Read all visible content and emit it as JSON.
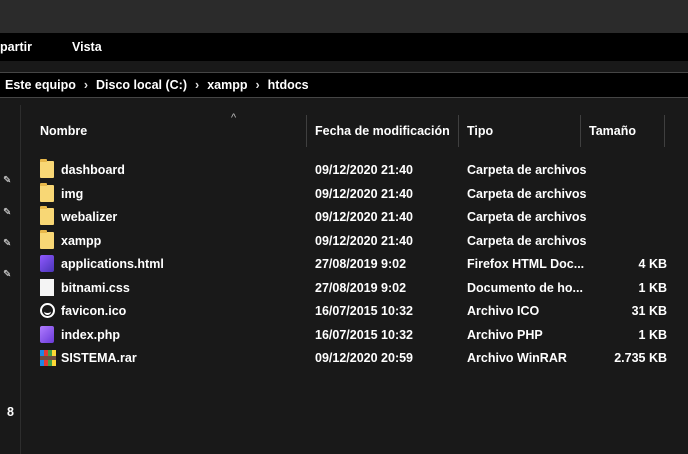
{
  "ribbon": {
    "compartir_label": "partir",
    "vista_label": "Vista"
  },
  "address": {
    "breadcrumbs": [
      "Este equipo",
      "Disco local (C:)",
      "xampp",
      "htdocs"
    ],
    "separator": "›"
  },
  "navpane": {
    "pin_glyph": "✎",
    "number": "8"
  },
  "columns": {
    "name": "Nombre",
    "modified": "Fecha de modificación",
    "type": "Tipo",
    "size": "Tamaño",
    "sort_indicator": "^"
  },
  "files": [
    {
      "name": "dashboard",
      "modified": "09/12/2020 21:40",
      "type": "Carpeta de archivos",
      "size": "",
      "icon": "folder-icon"
    },
    {
      "name": "img",
      "modified": "09/12/2020 21:40",
      "type": "Carpeta de archivos",
      "size": "",
      "icon": "folder-icon"
    },
    {
      "name": "webalizer",
      "modified": "09/12/2020 21:40",
      "type": "Carpeta de archivos",
      "size": "",
      "icon": "folder-icon"
    },
    {
      "name": "xampp",
      "modified": "09/12/2020 21:40",
      "type": "Carpeta de archivos",
      "size": "",
      "icon": "folder-icon"
    },
    {
      "name": "applications.html",
      "modified": "27/08/2019 9:02",
      "type": "Firefox HTML Doc...",
      "size": "4 KB",
      "icon": "firefox-html-icon"
    },
    {
      "name": "bitnami.css",
      "modified": "27/08/2019 9:02",
      "type": "Documento de ho...",
      "size": "1 KB",
      "icon": "document-icon"
    },
    {
      "name": "favicon.ico",
      "modified": "16/07/2015 10:32",
      "type": "Archivo ICO",
      "size": "31 KB",
      "icon": "ico-file-icon"
    },
    {
      "name": "index.php",
      "modified": "16/07/2015 10:32",
      "type": "Archivo PHP",
      "size": "1 KB",
      "icon": "php-file-icon"
    },
    {
      "name": "SISTEMA.rar",
      "modified": "09/12/2020 20:59",
      "type": "Archivo WinRAR",
      "size": "2.735 KB",
      "icon": "winrar-icon"
    }
  ],
  "colors": {
    "background": "#191919",
    "ribbon": "#000000",
    "titlebar": "#2b2b2b",
    "folder": "#f8d775"
  }
}
